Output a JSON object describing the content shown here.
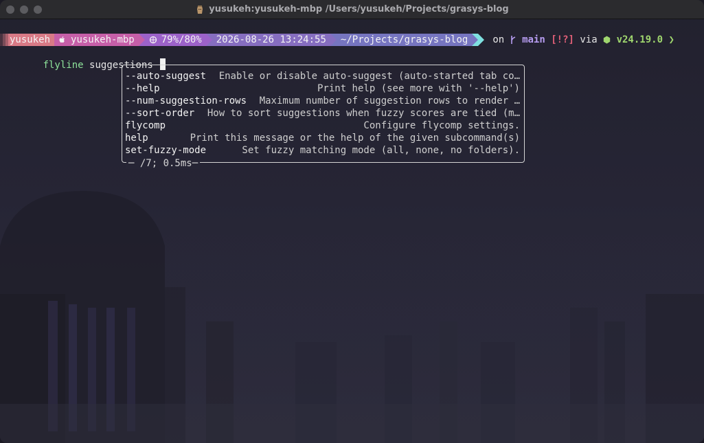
{
  "window": {
    "title": "yusukeh:yusukeh-mbp /Users/yusukeh/Projects/grasys-blog",
    "title_icon": "moai-icon"
  },
  "prompt": {
    "user": "yusukeh",
    "host": "yusukeh-mbp",
    "battery": "79%/80%",
    "datetime": "2026-08-26 13:24:55",
    "path": "~/Projects/grasys-blog",
    "on": "on",
    "branch": "main",
    "git_status": "[!?]",
    "via": "via",
    "node_version": "v24.19.0",
    "chevron": "❯",
    "colors": {
      "user": "#d87a86",
      "host": "#c65fa8",
      "battery": "#9c62c9",
      "time": "#866ec0",
      "path": "#7675c0",
      "end": "#7ee0e0"
    }
  },
  "command": {
    "name": "flyline",
    "argument": "suggestions"
  },
  "suggestions": {
    "items": [
      {
        "name": "--auto-suggest",
        "desc": "Enable or disable auto-suggest (auto-started tab co…"
      },
      {
        "name": "--help",
        "desc": "Print help (see more with '--help')"
      },
      {
        "name": "--num-suggestion-rows",
        "desc": "Maximum number of suggestion rows to render …"
      },
      {
        "name": "--sort-order",
        "desc": "How to sort suggestions when fuzzy scores are tied (m…"
      },
      {
        "name": "flycomp",
        "desc": "Configure flycomp settings."
      },
      {
        "name": "help",
        "desc": "Print this message or the help of the given subcommand(s)"
      },
      {
        "name": "set-fuzzy-mode",
        "desc": "Set fuzzy matching mode (all, none, no folders)."
      }
    ],
    "footer": "─ /7; 0.5ms─"
  }
}
